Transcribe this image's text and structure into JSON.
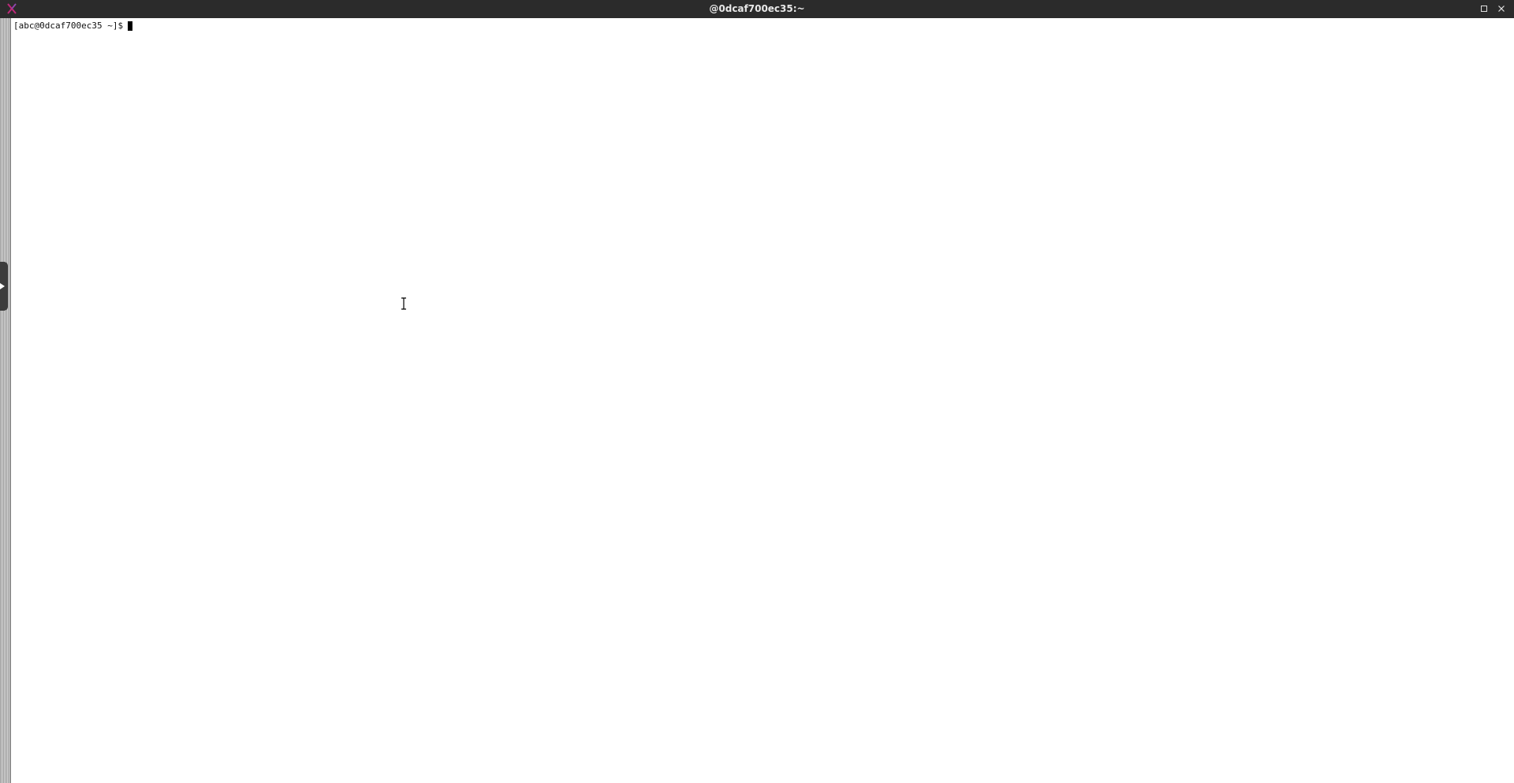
{
  "window": {
    "title": "@0dcaf700ec35:~",
    "app_icon": "x-terminal-icon",
    "controls": [
      "maximize-icon",
      "close-icon"
    ]
  },
  "terminal": {
    "prompt": "[abc@0dcaf700ec35 ~]$"
  },
  "colors": {
    "titlebar_bg": "#2b2b2b",
    "terminal_bg": "#ffffff",
    "text": "#111111",
    "app_icon_accent": "#c0287a"
  }
}
